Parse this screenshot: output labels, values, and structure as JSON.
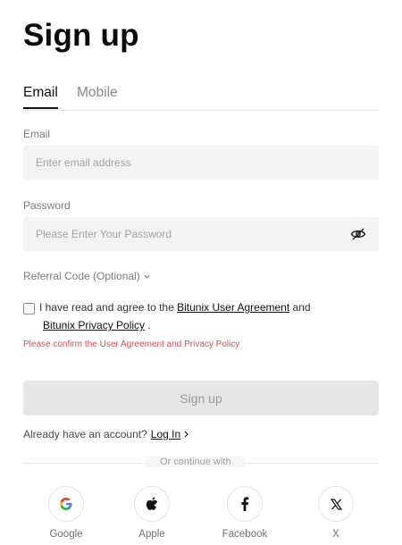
{
  "page": {
    "title": "Sign up"
  },
  "tabs": [
    {
      "label": "Email",
      "active": true
    },
    {
      "label": "Mobile",
      "active": false
    }
  ],
  "email": {
    "label": "Email",
    "placeholder": "Enter email address",
    "value": ""
  },
  "password": {
    "label": "Password",
    "placeholder": "Please Enter Your Password",
    "value": "",
    "toggle_icon": "eye-off-icon"
  },
  "referral": {
    "label": "Referral Code (Optional)",
    "icon": "chevron-down-icon"
  },
  "agreement": {
    "checked": false,
    "prefix": "I have read and agree to the",
    "user_agreement": "Bitunix User Agreement",
    "conjunction": "and",
    "privacy_policy": "Bitunix Privacy Policy",
    "suffix": ".",
    "error": "Please confirm the User Agreement and Privacy Policy"
  },
  "signup_button": {
    "label": "Sign up",
    "disabled": true
  },
  "login": {
    "prompt": "Already have an account?",
    "link": "Log In"
  },
  "divider": {
    "text": "Or continue with"
  },
  "social": [
    {
      "label": "Google",
      "icon": "google-icon"
    },
    {
      "label": "Apple",
      "icon": "apple-icon"
    },
    {
      "label": "Facebook",
      "icon": "facebook-icon"
    },
    {
      "label": "X",
      "icon": "x-icon"
    }
  ],
  "colors": {
    "error": "#e5484d",
    "button_disabled_bg": "#e6e6e6",
    "input_bg": "#f3f3f3",
    "text_primary": "#111111"
  }
}
